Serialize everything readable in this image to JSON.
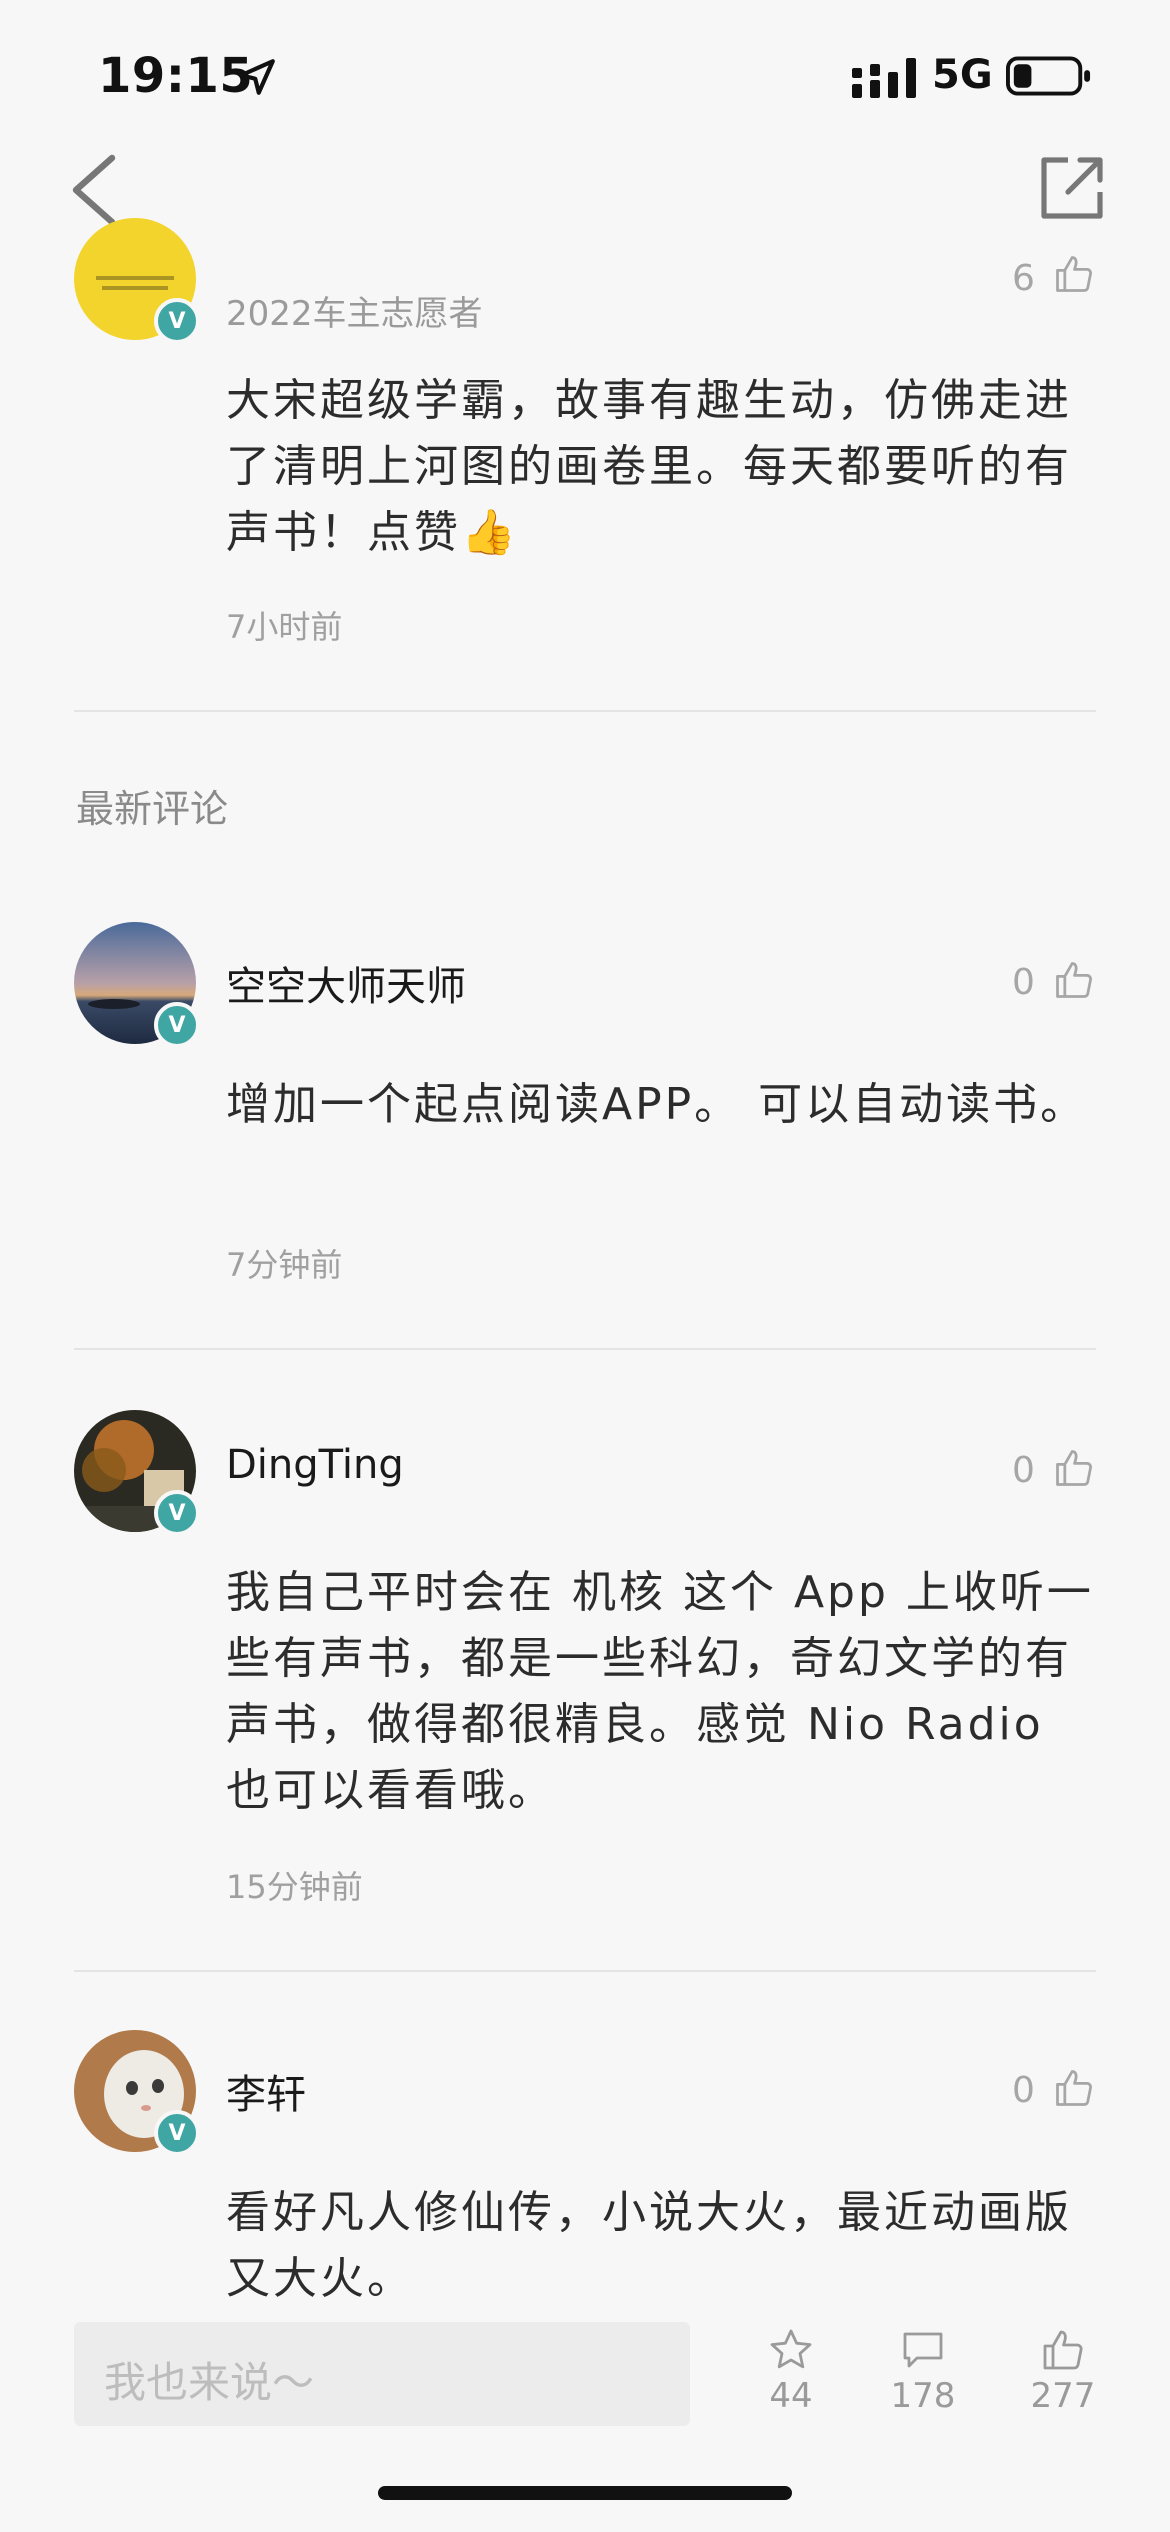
{
  "status_bar": {
    "time": "19:15",
    "network": "5G"
  },
  "top_comment": {
    "subtitle": "2022车主志愿者",
    "like_count": "6",
    "text": "大宋超级学霸，故事有趣生动，仿佛走进了清明上河图的画卷里。每天都要听的有声书！点赞",
    "emoji": "👍",
    "time_ago": "7小时前"
  },
  "section_title": "最新评论",
  "comments": [
    {
      "username": "空空大师天师",
      "likes": "0",
      "text": "增加一个起点阅读APP。 可以自动读书。",
      "time_ago": "7分钟前"
    },
    {
      "username": "DingTing",
      "likes": "0",
      "text": "我自己平时会在 机核 这个 App 上收听一些有声书，都是一些科幻，奇幻文学的有声书，做得都很精良。感觉 Nio Radio 也可以看看哦。",
      "time_ago": "15分钟前"
    },
    {
      "username": "李轩",
      "likes": "0",
      "text": "看好凡人修仙传，小说大火，最近动画版又大火。"
    }
  ],
  "badge_letter": "V",
  "bottom_bar": {
    "input_placeholder": "我也来说～",
    "favorites": "44",
    "comments": "178",
    "likes": "277"
  }
}
